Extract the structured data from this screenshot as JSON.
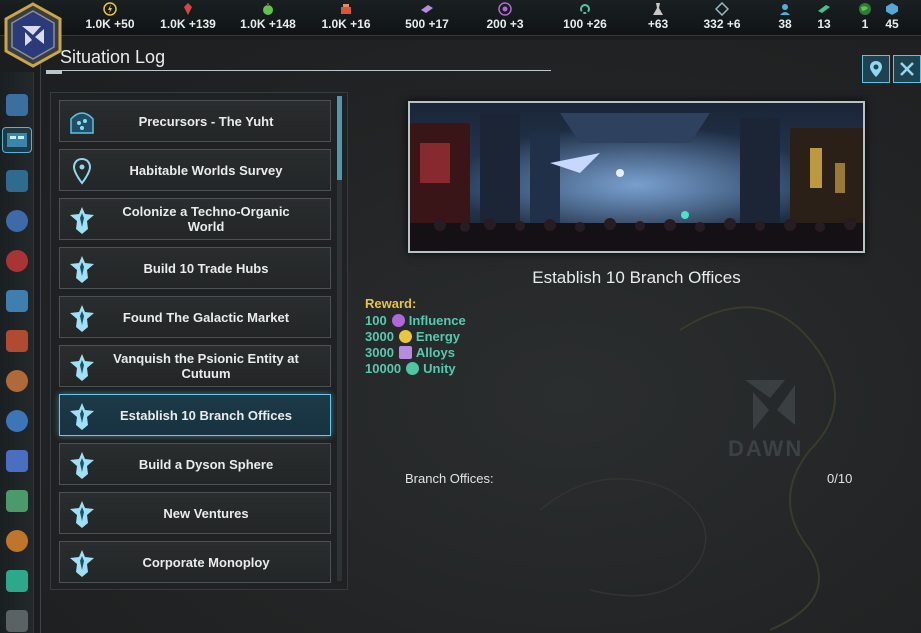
{
  "resources": [
    {
      "name": "energy-icon",
      "color": "#e9c63a",
      "value": "1.0K +50"
    },
    {
      "name": "minerals-icon",
      "color": "#d8473e",
      "value": "1.0K +139"
    },
    {
      "name": "food-icon",
      "color": "#62c24a",
      "value": "1.0K +148"
    },
    {
      "name": "consumer-goods-icon",
      "color": "#d8573a",
      "value": "1.0K +16"
    },
    {
      "name": "alloys-icon",
      "color": "#b68be0",
      "value": "500 +17"
    },
    {
      "name": "influence-icon",
      "color": "#b068d8",
      "value": "200 +3"
    },
    {
      "name": "unity-icon",
      "color": "#4ec6a4",
      "value": "100 +26"
    },
    {
      "name": "research-icon",
      "color": "#c8c8c8",
      "value": "+63"
    },
    {
      "name": "naval-capacity-icon",
      "color": "#9ab6c2",
      "value": "332 +6"
    },
    {
      "name": "pops-icon",
      "color": "#4fb0d8",
      "value": "38"
    },
    {
      "name": "starbase-icon",
      "color": "#45c28d",
      "value": "13"
    },
    {
      "name": "planets-icon",
      "color": "#4fc05a",
      "value": "1"
    },
    {
      "name": "systems-icon",
      "color": "#53a8d8",
      "value": "45"
    }
  ],
  "panel": {
    "title": "Situation Log"
  },
  "situations": [
    {
      "label": "Precursors - The Yuht",
      "icon": "precursor-icon",
      "selected": false
    },
    {
      "label": "Habitable Worlds Survey",
      "icon": "map-pin-icon",
      "selected": false
    },
    {
      "label": "Colonize a Techno-Organic World",
      "icon": "star-pin-icon",
      "selected": false
    },
    {
      "label": "Build 10 Trade Hubs",
      "icon": "star-pin-icon",
      "selected": false
    },
    {
      "label": "Found The Galactic Market",
      "icon": "star-pin-icon",
      "selected": false
    },
    {
      "label": "Vanquish the Psionic Entity at Cutuum",
      "icon": "star-pin-icon",
      "selected": false
    },
    {
      "label": "Establish 10 Branch Offices",
      "icon": "star-pin-icon",
      "selected": true
    },
    {
      "label": "Build a Dyson Sphere",
      "icon": "star-pin-icon",
      "selected": false
    },
    {
      "label": "New Ventures",
      "icon": "star-pin-icon",
      "selected": false
    },
    {
      "label": "Corporate Monoploy",
      "icon": "star-pin-icon",
      "selected": false
    }
  ],
  "detail": {
    "title": "Establish 10 Branch Offices",
    "reward_label": "Reward:",
    "rewards": [
      {
        "amount": "100",
        "name": "Influence",
        "icon": "influence-icon",
        "color": "#b068d8"
      },
      {
        "amount": "3000",
        "name": "Energy",
        "icon": "energy-icon",
        "color": "#e9c63a"
      },
      {
        "amount": "3000",
        "name": "Alloys",
        "icon": "alloys-icon",
        "color": "#b68be0"
      },
      {
        "amount": "10000",
        "name": "Unity",
        "icon": "unity-icon",
        "color": "#4ec6a4"
      }
    ],
    "progress_label": "Branch Offices:",
    "progress_value": "0/10",
    "watermark": "DAWN"
  },
  "colors": {
    "accent": "#5cc3e2",
    "reward_text": "#56c9b1",
    "reward_label": "#e6c341"
  }
}
